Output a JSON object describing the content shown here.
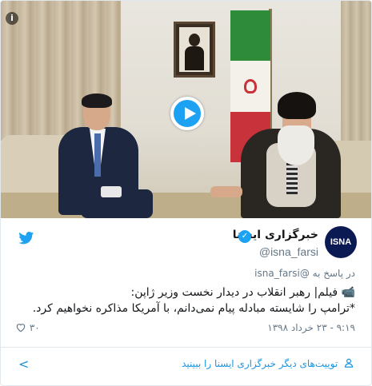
{
  "media": {
    "type": "video",
    "info_symbol": "i"
  },
  "author": {
    "avatar_text": "ISNA",
    "name": "خبرگزاری ایسنا",
    "verified": true,
    "handle": "@isna_farsi",
    "avatar_color": "#0b1a52"
  },
  "tweet": {
    "reply_prefix": "در پاسخ به",
    "reply_handle": "@isna_farsi",
    "line1": "📹 فیلم| رهبر انقلاب در دیدار نخست وزیر ژاپن:",
    "line2": "*ترامپ را شایسته مبادله پیام نمی‌دانم، با آمریکا مذاکره نخواهیم کرد.",
    "timestamp": "۹:۱۹ - ۲۳ خرداد ۱۳۹۸",
    "like_count": "۳۰"
  },
  "footer": {
    "more_label": "توییت‌های دیگر خبرگزاری ایسنا را ببینید",
    "chevron": "<"
  },
  "colors": {
    "accent": "#1da1f2",
    "link": "#1b95e0",
    "muted": "#657786",
    "text": "#14171a"
  },
  "icons": [
    "info-icon",
    "play-icon",
    "twitter-bird-icon",
    "verified-badge-icon",
    "heart-icon",
    "user-icon",
    "chevron-left-icon"
  ]
}
